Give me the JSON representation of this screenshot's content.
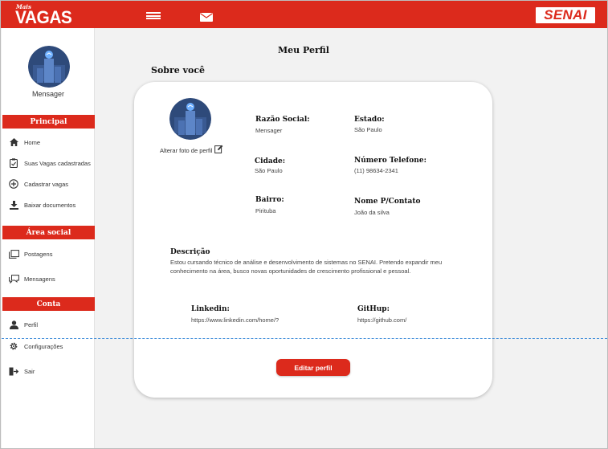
{
  "brand": {
    "pre": "Mais",
    "name": "VAGAS",
    "partner": "SENAI"
  },
  "header": {
    "menu_icon": "hamburger-icon",
    "mail_icon": "mail-icon"
  },
  "sidebar": {
    "user_name": "Mensager",
    "sections": [
      {
        "title": "Principal",
        "items": [
          {
            "label": "Home",
            "icon": "home-icon"
          },
          {
            "label": "Suas Vagas cadastradas",
            "icon": "clipboard-check-icon"
          },
          {
            "label": "Cadastrar vagas",
            "icon": "add-circle-icon"
          },
          {
            "label": "Baixar documentos",
            "icon": "download-icon"
          }
        ]
      },
      {
        "title": "Área social",
        "items": [
          {
            "label": "Postagens",
            "icon": "posts-icon"
          },
          {
            "label": "Mensagens",
            "icon": "chat-icon"
          }
        ]
      },
      {
        "title": "Conta",
        "items": [
          {
            "label": "Perfil",
            "icon": "user-icon"
          },
          {
            "label": "Configurações",
            "icon": "gear-icon"
          },
          {
            "label": "Sair",
            "icon": "logout-icon"
          }
        ]
      }
    ]
  },
  "main": {
    "title": "Meu Perfil",
    "subtitle": "Sobre você",
    "change_photo": "Alterar foto de perfil",
    "fields": {
      "razao_social": {
        "label": "Razão Social:",
        "value": "Mensager"
      },
      "estado": {
        "label": "Estado:",
        "value": "São Paulo"
      },
      "cidade": {
        "label": "Cidade:",
        "value": "São Paulo"
      },
      "telefone": {
        "label": "Número Telefone:",
        "value": "(11) 98634-2341"
      },
      "bairro": {
        "label": "Bairro:",
        "value": "Pirituba"
      },
      "contato": {
        "label": "Nome P/Contato",
        "value": "João da silva"
      },
      "descricao": {
        "label": "Descrição",
        "value": "Estou cursando técnico de análise e desenvolvimento de sistemas no SENAI.  Pretendo expandir meu conhecimento na área, busco novas oportunidades de crescimento profissional e pessoal."
      },
      "linkedin": {
        "label": "Linkedin:",
        "value": "https://www.linkedin.com/home/?"
      },
      "github": {
        "label": "GitHup:",
        "value": "https://github.com/"
      }
    },
    "edit_button": "Editar perfil"
  },
  "colors": {
    "accent": "#dc2a1c",
    "background": "#f2f2f2",
    "card": "#ffffff"
  }
}
